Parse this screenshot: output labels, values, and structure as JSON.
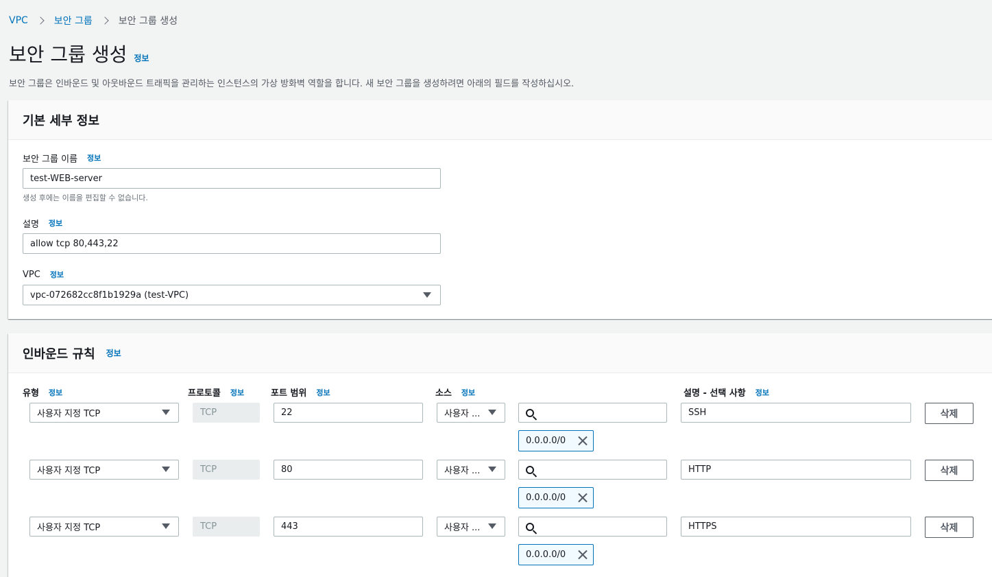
{
  "breadcrumb": {
    "items": [
      "VPC",
      "보안 그룹"
    ],
    "current": "보안 그룹 생성"
  },
  "page": {
    "title": "보안 그룹 생성",
    "info": "정보",
    "description": "보안 그룹은 인바운드 및 아웃바운드 트래픽을 관리하는 인스턴스의 가상 방화벽 역할을 합니다. 새 보안 그룹을 생성하려면 아래의 필드를 작성하십시오."
  },
  "basic": {
    "heading": "기본 세부 정보",
    "name_label": "보안 그룹 이름",
    "name_value": "test-WEB-server",
    "name_hint": "생성 후에는 이름을 편집할 수 없습니다.",
    "desc_label": "설명",
    "desc_value": "allow tcp 80,443,22",
    "vpc_label": "VPC",
    "vpc_value": "vpc-072682cc8f1b1929a (test-VPC)",
    "info": "정보"
  },
  "inbound": {
    "heading": "인바운드 규칙",
    "info": "정보",
    "columns": {
      "type": "유형",
      "protocol": "프로토콜",
      "port": "포트 범위",
      "source": "소스",
      "description": "설명 - 선택 사항"
    },
    "rules": [
      {
        "type": "사용자 지정 TCP",
        "protocol": "TCP",
        "port": "22",
        "source": "사용자 ...",
        "cidr": "0.0.0.0/0",
        "description": "SSH",
        "delete": "삭제"
      },
      {
        "type": "사용자 지정 TCP",
        "protocol": "TCP",
        "port": "80",
        "source": "사용자 ...",
        "cidr": "0.0.0.0/0",
        "description": "HTTP",
        "delete": "삭제"
      },
      {
        "type": "사용자 지정 TCP",
        "protocol": "TCP",
        "port": "443",
        "source": "사용자 ...",
        "cidr": "0.0.0.0/0",
        "description": "HTTPS",
        "delete": "삭제"
      }
    ]
  },
  "colors": {
    "link": "#0073bb",
    "background": "#f2f3f3",
    "token_border": "#0073bb"
  }
}
